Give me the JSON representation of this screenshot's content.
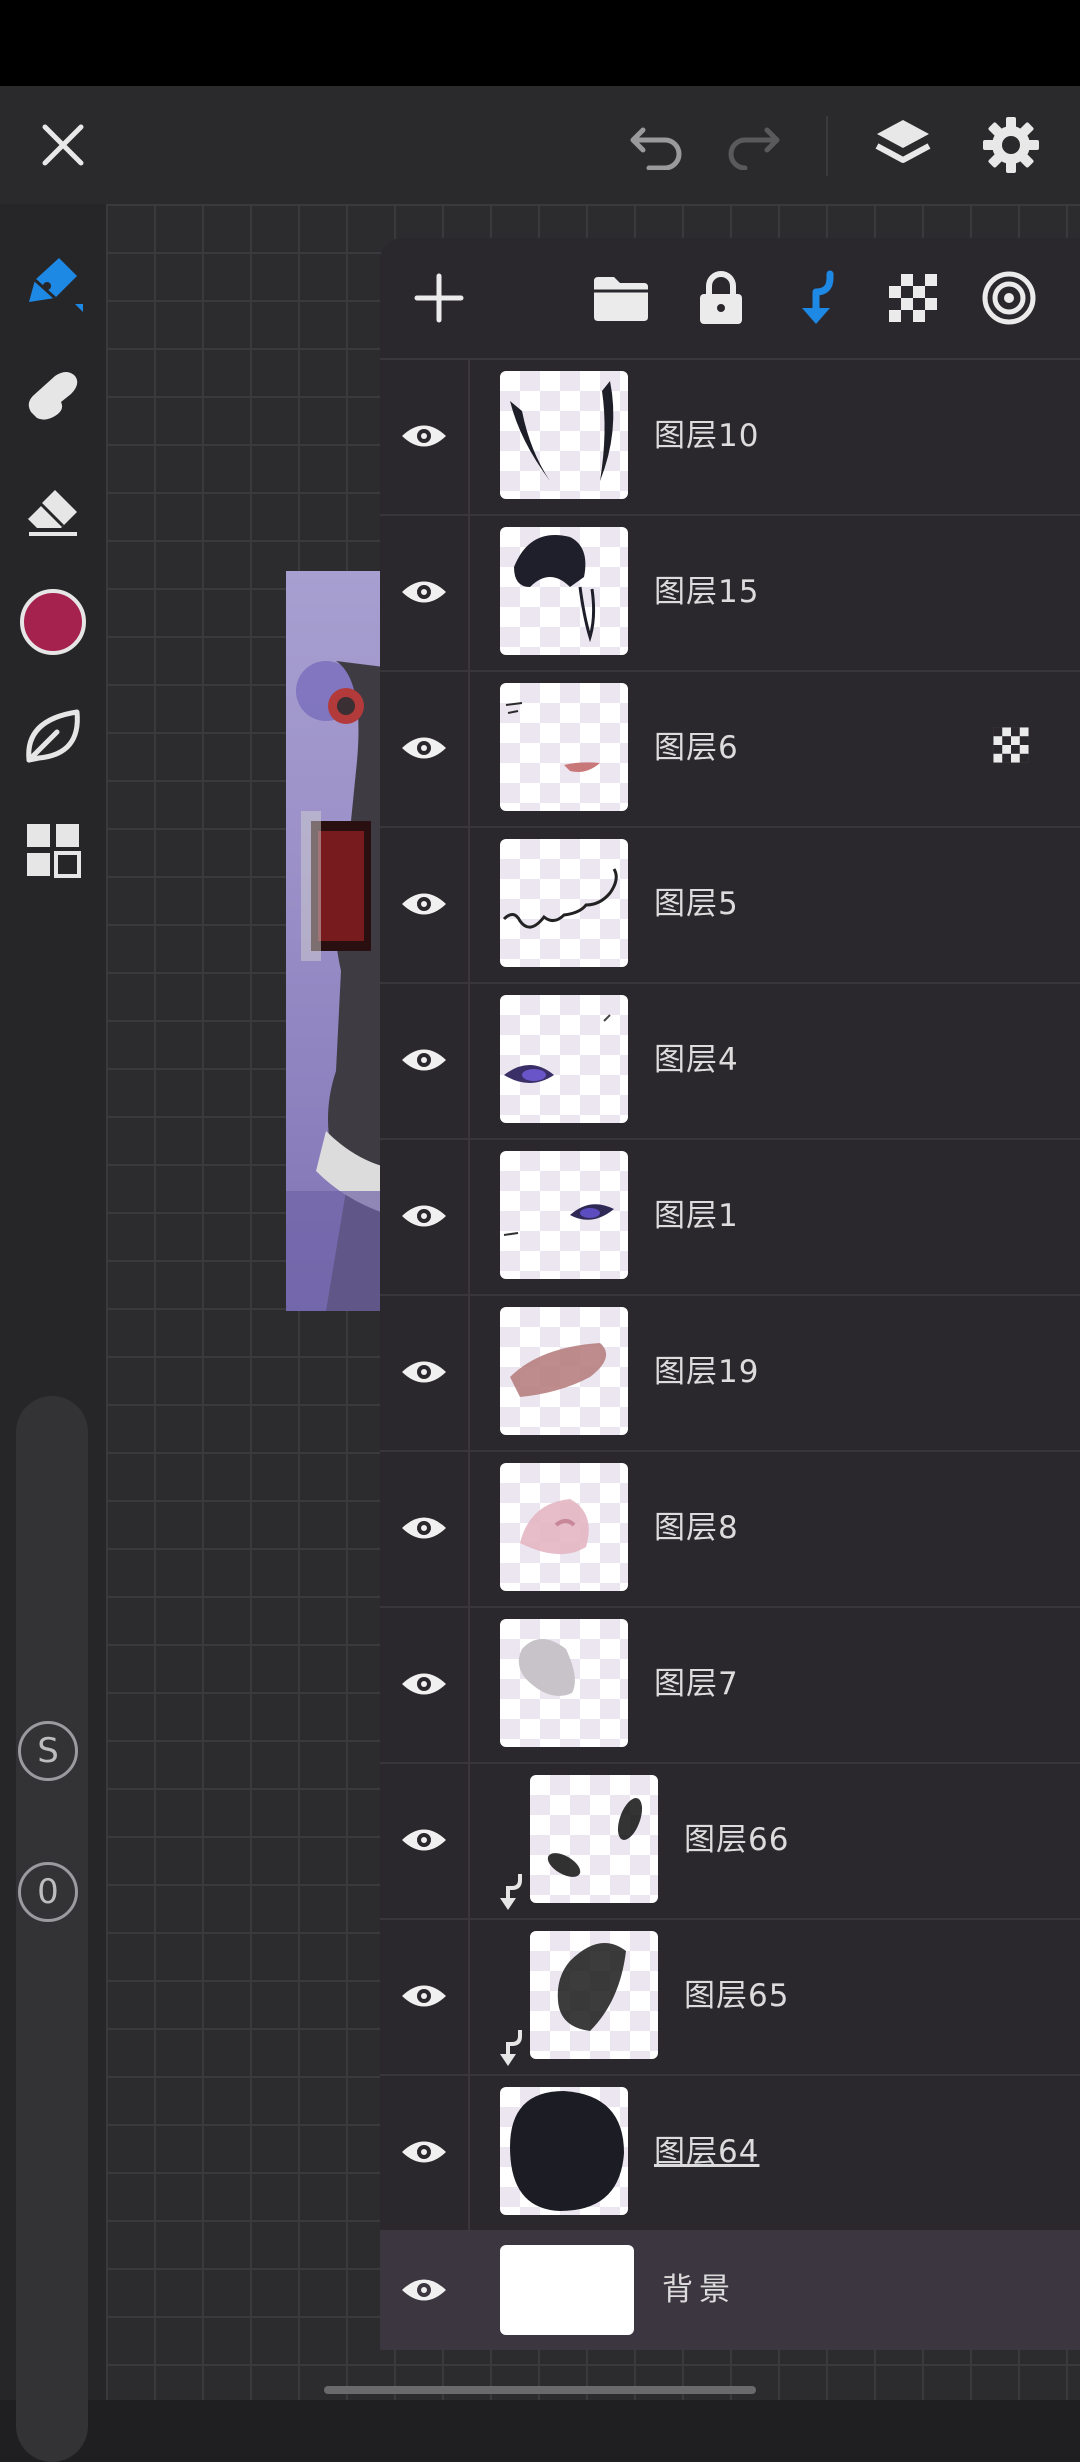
{
  "app": {
    "colors": {
      "accent": "#1e88e5",
      "brush_color": "#a5224e"
    }
  },
  "topbar": {
    "close_icon": "close-icon",
    "undo_icon": "undo-icon",
    "redo_icon": "redo-icon",
    "layers_icon": "layers-icon",
    "settings_icon": "gear-icon"
  },
  "toolbar": {
    "tools": [
      "pen-tool-icon",
      "smudge-icon",
      "eraser-icon",
      "color-swatch",
      "leaf-icon",
      "gallery-icon"
    ],
    "size_label": "S",
    "opacity_label": "0"
  },
  "layers_panel": {
    "toolbar": [
      "add-layer-icon",
      "folder-icon",
      "lock-icon",
      "clip-arrow-icon",
      "alpha-lock-icon",
      "blend-mode-icon"
    ],
    "layers": [
      {
        "name": "图层10",
        "visible": true,
        "clipped": false,
        "alpha_locked": false
      },
      {
        "name": "图层15",
        "visible": true,
        "clipped": false,
        "alpha_locked": false
      },
      {
        "name": "图层6",
        "visible": true,
        "clipped": false,
        "alpha_locked": true
      },
      {
        "name": "图层5",
        "visible": true,
        "clipped": false,
        "alpha_locked": false
      },
      {
        "name": "图层4",
        "visible": true,
        "clipped": false,
        "alpha_locked": false
      },
      {
        "name": "图层1",
        "visible": true,
        "clipped": false,
        "alpha_locked": false
      },
      {
        "name": "图层19",
        "visible": true,
        "clipped": false,
        "alpha_locked": false
      },
      {
        "name": "图层8",
        "visible": true,
        "clipped": false,
        "alpha_locked": false
      },
      {
        "name": "图层7",
        "visible": true,
        "clipped": false,
        "alpha_locked": false
      },
      {
        "name": "图层66",
        "visible": true,
        "clipped": true,
        "alpha_locked": false
      },
      {
        "name": "图层65",
        "visible": true,
        "clipped": true,
        "alpha_locked": false
      },
      {
        "name": "图层64",
        "visible": true,
        "clipped": false,
        "alpha_locked": false,
        "current": true
      },
      {
        "name": "背景",
        "visible": true,
        "clipped": false,
        "alpha_locked": false,
        "background": true
      }
    ]
  }
}
